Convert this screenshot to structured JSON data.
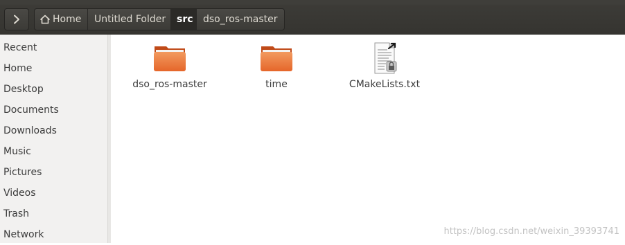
{
  "toolbar": {
    "nav_icon": "chevron-right-icon",
    "breadcrumbs": [
      {
        "label": "Home",
        "icon": "home-icon"
      },
      {
        "label": "Untitled Folder"
      },
      {
        "label": "src",
        "active": true
      },
      {
        "label": "dso_ros-master"
      }
    ]
  },
  "sidebar": {
    "items": [
      "Recent",
      "Home",
      "Desktop",
      "Documents",
      "Downloads",
      "Music",
      "Pictures",
      "Videos",
      "Trash",
      "Network"
    ]
  },
  "files": [
    {
      "name": "dso_ros-master",
      "type": "folder",
      "icon": "folder-icon"
    },
    {
      "name": "time",
      "type": "folder",
      "icon": "folder-icon"
    },
    {
      "name": "CMakeLists.txt",
      "type": "text-file",
      "icon": "text-file-locked-icon"
    }
  ],
  "watermark": "https://blog.csdn.net/weixin_39393741",
  "colors": {
    "toolbar_bg": "#3c3b37",
    "sidebar_bg": "#f2f1f0",
    "folder_orange": "#e5662a",
    "active_crumb_bg": "#2b2a27"
  }
}
